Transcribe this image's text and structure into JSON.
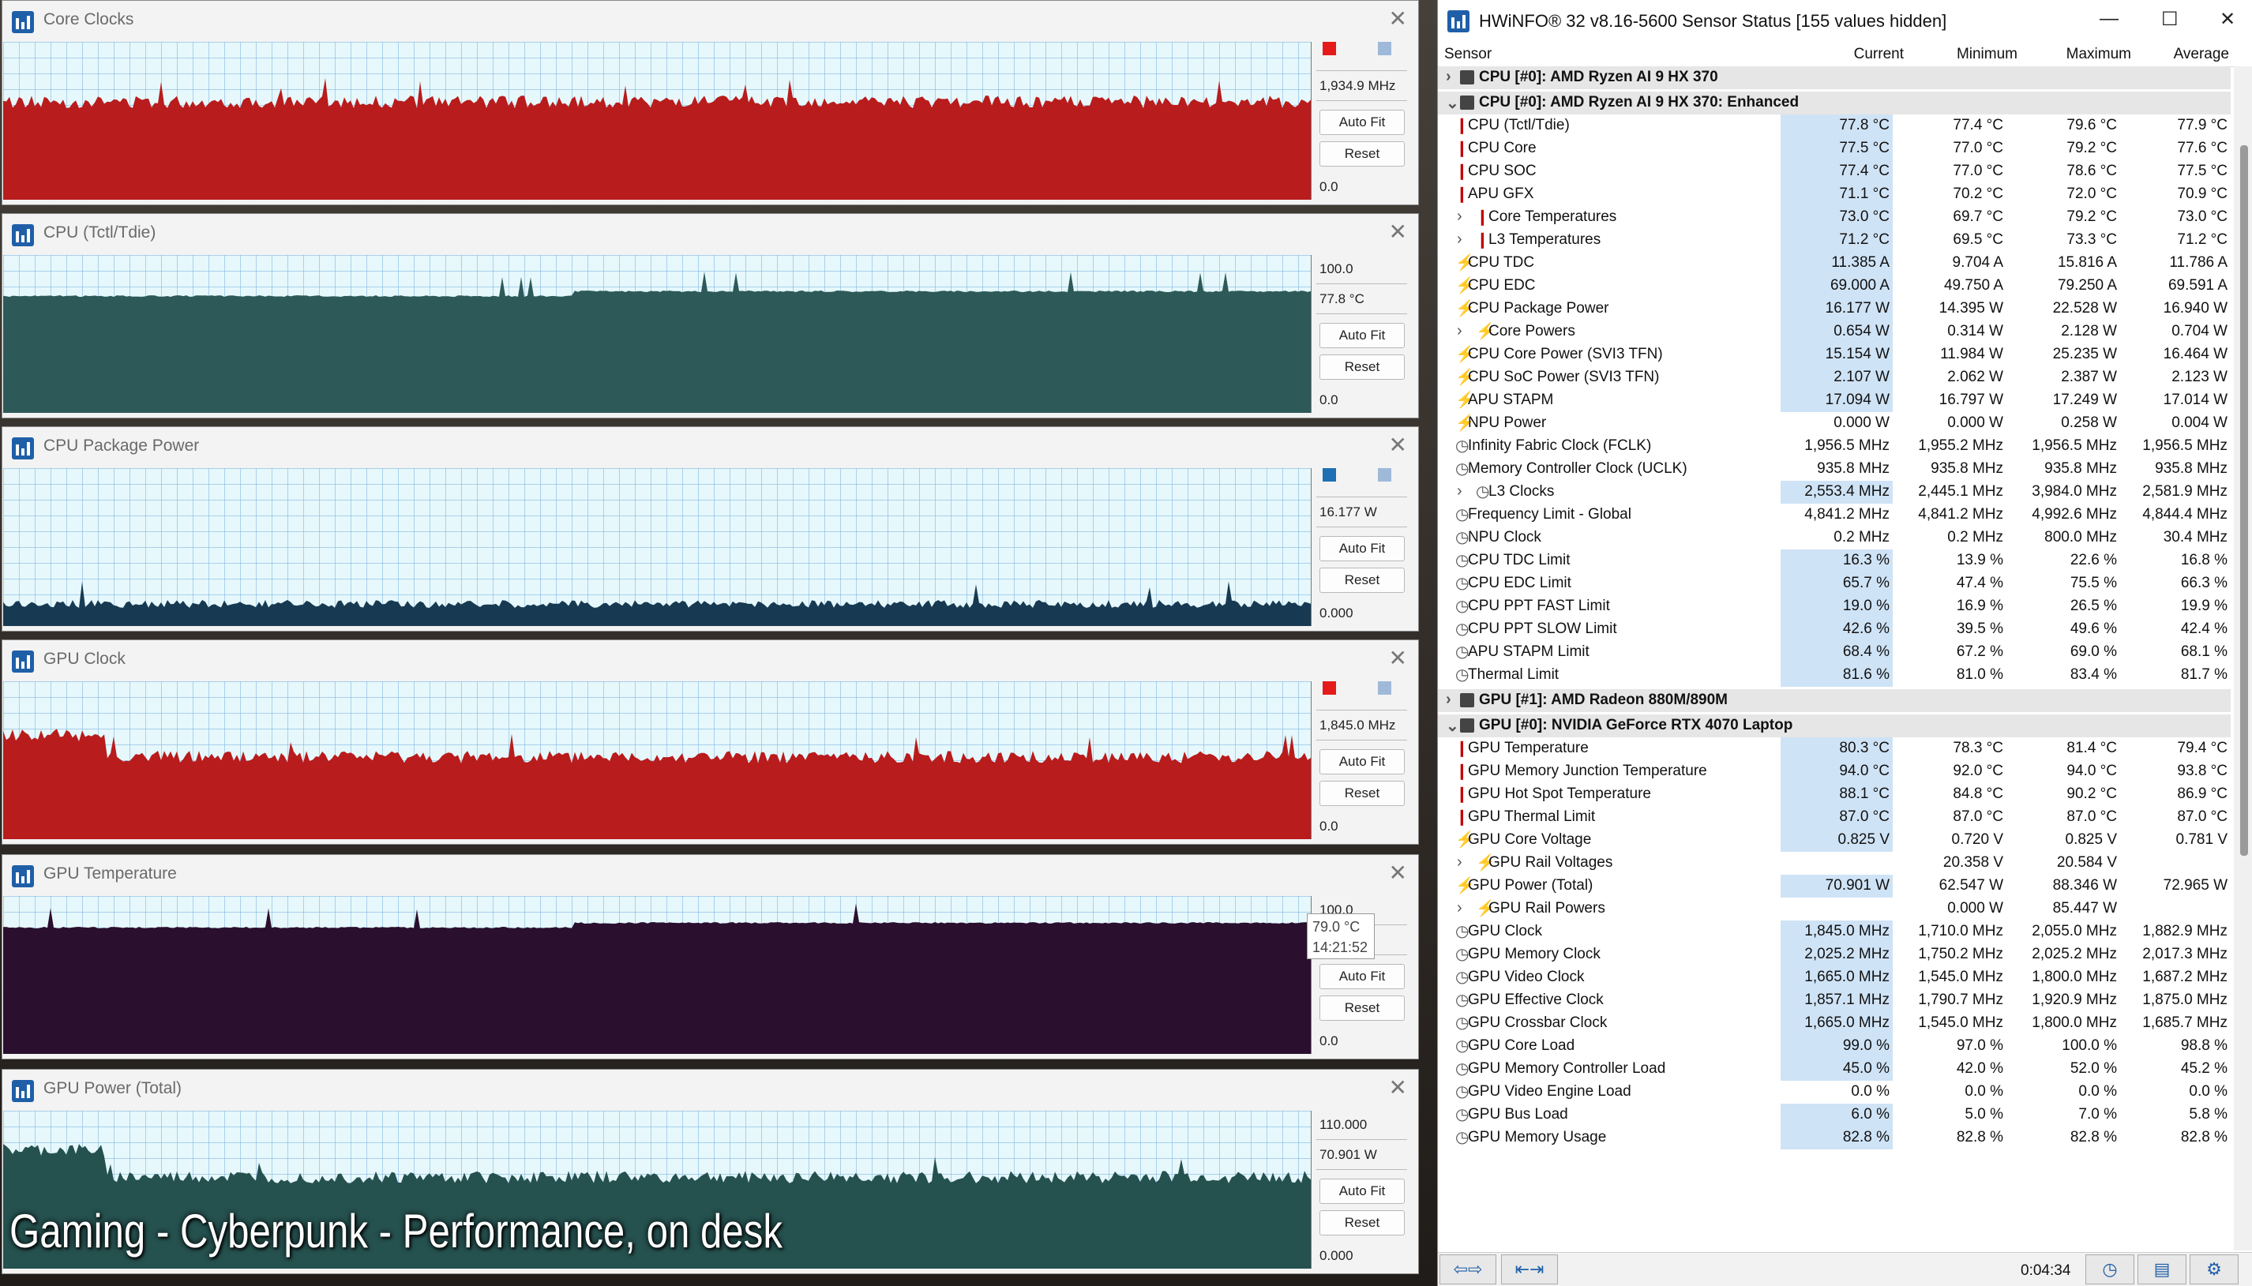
{
  "graphs": [
    {
      "title": "Core Clocks",
      "top_label": "",
      "current": "1,934.9 MHz",
      "bottom": "0.0",
      "autofit": "Auto Fit",
      "reset": "Reset",
      "color": "#b81c1c",
      "level": 0.62,
      "swatch": "#e51b1b"
    },
    {
      "title": "CPU (Tctl/Tdie)",
      "top_label": "100.0",
      "current": "77.8 °C",
      "bottom": "0.0",
      "autofit": "Auto Fit",
      "reset": "Reset",
      "color": "#2d5a58",
      "level": 0.74,
      "swatch": ""
    },
    {
      "title": "CPU Package Power",
      "top_label": "",
      "current": "16.177 W",
      "bottom": "0.000",
      "autofit": "Auto Fit",
      "reset": "Reset",
      "color": "#173a52",
      "level": 0.14,
      "swatch": "#1f6fb5"
    },
    {
      "title": "GPU Clock",
      "top_label": "",
      "current": "1,845.0 MHz",
      "bottom": "0.0",
      "autofit": "Auto Fit",
      "reset": "Reset",
      "color": "#b81c1c",
      "level": 0.52,
      "swatch": "#e51b1b"
    },
    {
      "title": "GPU Temperature",
      "top_label": "100.0",
      "current": "",
      "bottom": "0.0",
      "autofit": "Auto Fit",
      "reset": "Reset",
      "color": "#2b0f2f",
      "level": 0.8,
      "swatch": "",
      "tooltip_value": "79.0 °C",
      "tooltip_time": "14:21:52"
    },
    {
      "title": "GPU Power (Total)",
      "top_label": "110.000",
      "current": "70.901 W",
      "bottom": "0.000",
      "autofit": "Auto Fit",
      "reset": "Reset",
      "color": "#25514f",
      "level": 0.58,
      "swatch": ""
    }
  ],
  "caption": "Gaming - Cyberpunk - Performance, on desk",
  "hwinfo": {
    "title": "HWiNFO® 32 v8.16-5600 Sensor Status [155 values hidden]",
    "headers": {
      "sensor": "Sensor",
      "current": "Current",
      "minimum": "Minimum",
      "maximum": "Maximum",
      "average": "Average"
    },
    "rows": [
      {
        "type": "group",
        "label": "CPU [#0]: AMD Ryzen AI 9 HX 370",
        "collapsed": true
      },
      {
        "type": "gap"
      },
      {
        "type": "group",
        "label": "CPU [#0]: AMD Ryzen AI 9 HX 370: Enhanced",
        "collapsed": false
      },
      {
        "type": "row",
        "icon": "temp",
        "label": "CPU (Tctl/Tdie)",
        "cur": "77.8 °C",
        "min": "77.4 °C",
        "max": "79.6 °C",
        "avg": "77.9 °C",
        "hl": true
      },
      {
        "type": "row",
        "icon": "temp",
        "label": "CPU Core",
        "cur": "77.5 °C",
        "min": "77.0 °C",
        "max": "79.2 °C",
        "avg": "77.6 °C",
        "hl": true
      },
      {
        "type": "row",
        "icon": "temp",
        "label": "CPU SOC",
        "cur": "77.4 °C",
        "min": "77.0 °C",
        "max": "78.6 °C",
        "avg": "77.5 °C",
        "hl": true
      },
      {
        "type": "row",
        "icon": "temp",
        "label": "APU GFX",
        "cur": "71.1 °C",
        "min": "70.2 °C",
        "max": "72.0 °C",
        "avg": "70.9 °C",
        "hl": true
      },
      {
        "type": "row",
        "icon": "temp",
        "label": "Core Temperatures",
        "sub": true,
        "cur": "73.0 °C",
        "min": "69.7 °C",
        "max": "79.2 °C",
        "avg": "73.0 °C",
        "hl": true
      },
      {
        "type": "row",
        "icon": "temp",
        "label": "L3 Temperatures",
        "sub": true,
        "cur": "71.2 °C",
        "min": "69.5 °C",
        "max": "73.3 °C",
        "avg": "71.2 °C",
        "hl": true
      },
      {
        "type": "row",
        "icon": "bolt",
        "label": "CPU TDC",
        "cur": "11.385 A",
        "min": "9.704 A",
        "max": "15.816 A",
        "avg": "11.786 A",
        "hl": true
      },
      {
        "type": "row",
        "icon": "bolt",
        "label": "CPU EDC",
        "cur": "69.000 A",
        "min": "49.750 A",
        "max": "79.250 A",
        "avg": "69.591 A",
        "hl": true
      },
      {
        "type": "row",
        "icon": "bolt",
        "label": "CPU Package Power",
        "cur": "16.177 W",
        "min": "14.395 W",
        "max": "22.528 W",
        "avg": "16.940 W",
        "hl": true
      },
      {
        "type": "row",
        "icon": "bolt",
        "label": "Core Powers",
        "sub": true,
        "cur": "0.654 W",
        "min": "0.314 W",
        "max": "2.128 W",
        "avg": "0.704 W",
        "hl": true
      },
      {
        "type": "row",
        "icon": "bolt",
        "label": "CPU Core Power (SVI3 TFN)",
        "cur": "15.154 W",
        "min": "11.984 W",
        "max": "25.235 W",
        "avg": "16.464 W",
        "hl": true
      },
      {
        "type": "row",
        "icon": "bolt",
        "label": "CPU SoC Power (SVI3 TFN)",
        "cur": "2.107 W",
        "min": "2.062 W",
        "max": "2.387 W",
        "avg": "2.123 W",
        "hl": true
      },
      {
        "type": "row",
        "icon": "bolt",
        "label": "APU STAPM",
        "cur": "17.094 W",
        "min": "16.797 W",
        "max": "17.249 W",
        "avg": "17.014 W",
        "hl": true
      },
      {
        "type": "row",
        "icon": "bolt",
        "label": "NPU Power",
        "cur": "0.000 W",
        "min": "0.000 W",
        "max": "0.258 W",
        "avg": "0.004 W",
        "hl": false
      },
      {
        "type": "row",
        "icon": "clk",
        "label": "Infinity Fabric Clock (FCLK)",
        "cur": "1,956.5 MHz",
        "min": "1,955.2 MHz",
        "max": "1,956.5 MHz",
        "avg": "1,956.5 MHz",
        "hl": false
      },
      {
        "type": "row",
        "icon": "clk",
        "label": "Memory Controller Clock (UCLK)",
        "cur": "935.8 MHz",
        "min": "935.8 MHz",
        "max": "935.8 MHz",
        "avg": "935.8 MHz",
        "hl": false
      },
      {
        "type": "row",
        "icon": "clk",
        "label": "L3 Clocks",
        "sub": true,
        "cur": "2,553.4 MHz",
        "min": "2,445.1 MHz",
        "max": "3,984.0 MHz",
        "avg": "2,581.9 MHz",
        "hl": true
      },
      {
        "type": "row",
        "icon": "clk",
        "label": "Frequency Limit - Global",
        "cur": "4,841.2 MHz",
        "min": "4,841.2 MHz",
        "max": "4,992.6 MHz",
        "avg": "4,844.4 MHz",
        "hl": false
      },
      {
        "type": "row",
        "icon": "clk",
        "label": "NPU Clock",
        "cur": "0.2 MHz",
        "min": "0.2 MHz",
        "max": "800.0 MHz",
        "avg": "30.4 MHz",
        "hl": false
      },
      {
        "type": "row",
        "icon": "clk",
        "label": "CPU TDC Limit",
        "cur": "16.3 %",
        "min": "13.9 %",
        "max": "22.6 %",
        "avg": "16.8 %",
        "hl": true
      },
      {
        "type": "row",
        "icon": "clk",
        "label": "CPU EDC Limit",
        "cur": "65.7 %",
        "min": "47.4 %",
        "max": "75.5 %",
        "avg": "66.3 %",
        "hl": true
      },
      {
        "type": "row",
        "icon": "clk",
        "label": "CPU PPT FAST Limit",
        "cur": "19.0 %",
        "min": "16.9 %",
        "max": "26.5 %",
        "avg": "19.9 %",
        "hl": true
      },
      {
        "type": "row",
        "icon": "clk",
        "label": "CPU PPT SLOW Limit",
        "cur": "42.6 %",
        "min": "39.5 %",
        "max": "49.6 %",
        "avg": "42.4 %",
        "hl": true
      },
      {
        "type": "row",
        "icon": "clk",
        "label": "APU STAPM Limit",
        "cur": "68.4 %",
        "min": "67.2 %",
        "max": "69.0 %",
        "avg": "68.1 %",
        "hl": true
      },
      {
        "type": "row",
        "icon": "clk",
        "label": "Thermal Limit",
        "cur": "81.6 %",
        "min": "81.0 %",
        "max": "83.4 %",
        "avg": "81.7 %",
        "hl": true
      },
      {
        "type": "gap"
      },
      {
        "type": "group",
        "label": "GPU [#1]: AMD Radeon 880M/890M",
        "collapsed": true
      },
      {
        "type": "gap"
      },
      {
        "type": "group",
        "label": "GPU [#0]: NVIDIA GeForce RTX 4070 Laptop",
        "collapsed": false
      },
      {
        "type": "row",
        "icon": "temp",
        "label": "GPU Temperature",
        "cur": "80.3 °C",
        "min": "78.3 °C",
        "max": "81.4 °C",
        "avg": "79.4 °C",
        "hl": true
      },
      {
        "type": "row",
        "icon": "temp",
        "label": "GPU Memory Junction Temperature",
        "cur": "94.0 °C",
        "min": "92.0 °C",
        "max": "94.0 °C",
        "avg": "93.8 °C",
        "hl": true
      },
      {
        "type": "row",
        "icon": "temp",
        "label": "GPU Hot Spot Temperature",
        "cur": "88.1 °C",
        "min": "84.8 °C",
        "max": "90.2 °C",
        "avg": "86.9 °C",
        "hl": true
      },
      {
        "type": "row",
        "icon": "temp",
        "label": "GPU Thermal Limit",
        "cur": "87.0 °C",
        "min": "87.0 °C",
        "max": "87.0 °C",
        "avg": "87.0 °C",
        "hl": true
      },
      {
        "type": "row",
        "icon": "bolt",
        "label": "GPU Core Voltage",
        "cur": "0.825 V",
        "min": "0.720 V",
        "max": "0.825 V",
        "avg": "0.781 V",
        "hl": true
      },
      {
        "type": "row",
        "icon": "bolt",
        "label": "GPU Rail Voltages",
        "sub": true,
        "cur": "",
        "min": "20.358 V",
        "max": "20.584 V",
        "avg": "",
        "hl": false
      },
      {
        "type": "row",
        "icon": "bolt",
        "label": "GPU Power (Total)",
        "cur": "70.901 W",
        "min": "62.547 W",
        "max": "88.346 W",
        "avg": "72.965 W",
        "hl": true
      },
      {
        "type": "row",
        "icon": "bolt",
        "label": "GPU Rail Powers",
        "sub": true,
        "cur": "",
        "min": "0.000 W",
        "max": "85.447 W",
        "avg": "",
        "hl": false
      },
      {
        "type": "row",
        "icon": "clk",
        "label": "GPU Clock",
        "cur": "1,845.0 MHz",
        "min": "1,710.0 MHz",
        "max": "2,055.0 MHz",
        "avg": "1,882.9 MHz",
        "hl": true
      },
      {
        "type": "row",
        "icon": "clk",
        "label": "GPU Memory Clock",
        "cur": "2,025.2 MHz",
        "min": "1,750.2 MHz",
        "max": "2,025.2 MHz",
        "avg": "2,017.3 MHz",
        "hl": true
      },
      {
        "type": "row",
        "icon": "clk",
        "label": "GPU Video Clock",
        "cur": "1,665.0 MHz",
        "min": "1,545.0 MHz",
        "max": "1,800.0 MHz",
        "avg": "1,687.2 MHz",
        "hl": true
      },
      {
        "type": "row",
        "icon": "clk",
        "label": "GPU Effective Clock",
        "cur": "1,857.1 MHz",
        "min": "1,790.7 MHz",
        "max": "1,920.9 MHz",
        "avg": "1,875.0 MHz",
        "hl": true
      },
      {
        "type": "row",
        "icon": "clk",
        "label": "GPU Crossbar Clock",
        "cur": "1,665.0 MHz",
        "min": "1,545.0 MHz",
        "max": "1,800.0 MHz",
        "avg": "1,685.7 MHz",
        "hl": true
      },
      {
        "type": "row",
        "icon": "clk",
        "label": "GPU Core Load",
        "cur": "99.0 %",
        "min": "97.0 %",
        "max": "100.0 %",
        "avg": "98.8 %",
        "hl": true
      },
      {
        "type": "row",
        "icon": "clk",
        "label": "GPU Memory Controller Load",
        "cur": "45.0 %",
        "min": "42.0 %",
        "max": "52.0 %",
        "avg": "45.2 %",
        "hl": true
      },
      {
        "type": "row",
        "icon": "clk",
        "label": "GPU Video Engine Load",
        "cur": "0.0 %",
        "min": "0.0 %",
        "max": "0.0 %",
        "avg": "0.0 %",
        "hl": false
      },
      {
        "type": "row",
        "icon": "clk",
        "label": "GPU Bus Load",
        "cur": "6.0 %",
        "min": "5.0 %",
        "max": "7.0 %",
        "avg": "5.8 %",
        "hl": true
      },
      {
        "type": "row",
        "icon": "clk",
        "label": "GPU Memory Usage",
        "cur": "82.8 %",
        "min": "82.8 %",
        "max": "82.8 %",
        "avg": "82.8 %",
        "hl": true
      }
    ],
    "footer_time": "0:04:34"
  }
}
